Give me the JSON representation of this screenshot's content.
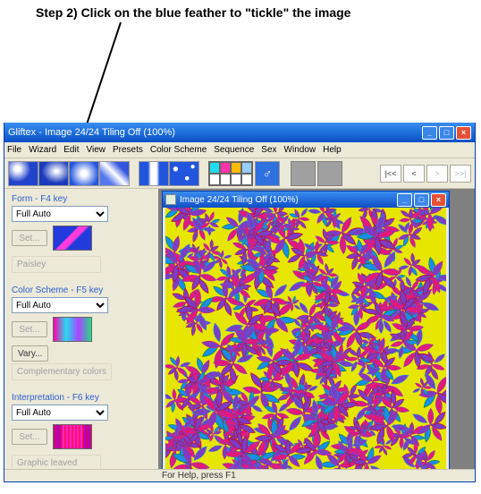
{
  "annotation": "Step 2) Click on the blue feather to \"tickle\" the image",
  "app_title": "Gliftex - Image 24/24 Tiling Off (100%)",
  "menu": [
    "File",
    "Wizard",
    "Edit",
    "View",
    "Presets",
    "Color Scheme",
    "Sequence",
    "Sex",
    "Window",
    "Help"
  ],
  "nav": {
    "first": "|<<",
    "prev": "<",
    "next": ">",
    "last": ">>|"
  },
  "panels": {
    "form": {
      "label": "Form - F4 key",
      "mode": "Full Auto",
      "set": "Set...",
      "subtype": "Paisley"
    },
    "color": {
      "label": "Color Scheme - F5 key",
      "mode": "Full Auto",
      "set": "Set...",
      "vary": "Vary...",
      "subtype": "Complementary colors"
    },
    "interp": {
      "label": "Interpretation - F6 key",
      "mode": "Full Auto",
      "set": "Set...",
      "subtype": "Graphic leaved"
    }
  },
  "doc_title": "Image 24/24 Tiling Off (100%)",
  "status": "For Help, press F1",
  "win_btns": {
    "min": "_",
    "max": "□",
    "close": "×"
  }
}
